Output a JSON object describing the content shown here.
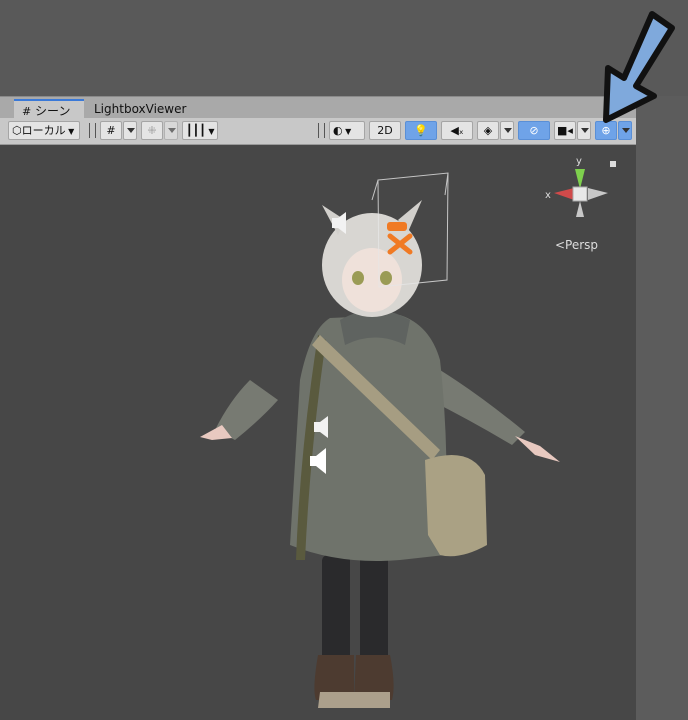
{
  "tabs": [
    {
      "label": "シーン",
      "icon": "grid-icon",
      "active": true
    },
    {
      "label": "LightboxViewer",
      "active": false
    }
  ],
  "toolbar": {
    "pivot_label": "ローカル",
    "button_2d": "2D",
    "accent": "#6fa3e8"
  },
  "scene": {
    "projection_label": "<Persp",
    "gizmo_axes": {
      "x": "x",
      "y": "y"
    },
    "background": "#474747"
  },
  "annotation": {
    "icon": "arrow-down-left-icon",
    "color": "#7fa9dc"
  }
}
